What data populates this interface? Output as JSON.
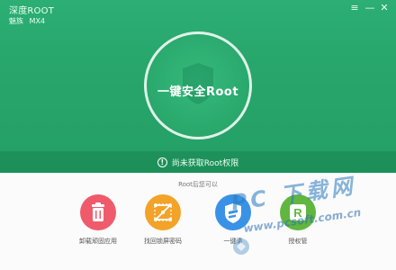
{
  "window": {
    "title": "深度ROOT",
    "controls": {
      "menu_icon": "≡",
      "minimize_icon": "—",
      "close_icon": "✕"
    }
  },
  "device": {
    "model_label": "魅族",
    "model_value": "MX4"
  },
  "main_button": {
    "label": "一键安全Root"
  },
  "status": {
    "text": "尚未获取Root权限"
  },
  "features": {
    "caption": "Root后您可以",
    "items": [
      {
        "label": "卸载顽固应用",
        "icon": "trash-icon",
        "color": "#ef5b6b"
      },
      {
        "label": "找回锁屏密码",
        "icon": "pattern-lock-icon",
        "color": "#f3a328"
      },
      {
        "label": "一键清",
        "icon": "clean-shield-icon",
        "color": "#3a92e6"
      },
      {
        "label": "授权管",
        "icon": "r-letter-icon",
        "color": "#61b640"
      }
    ]
  },
  "watermark": {
    "text": "PC 下载网",
    "url": "www.pcsoft.com.cn"
  },
  "colors": {
    "primary_green": "#27a56a",
    "bottom_bg": "#fbfbfb"
  }
}
